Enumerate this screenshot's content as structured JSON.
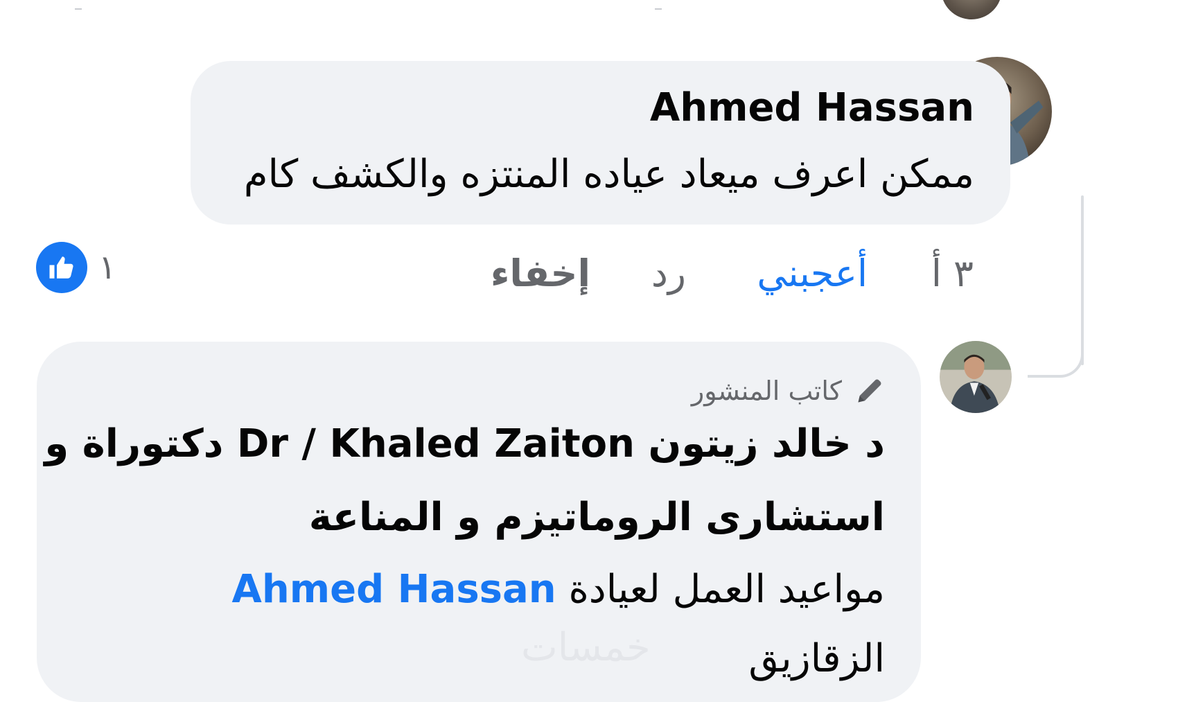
{
  "comment": {
    "author": "Ahmed Hassan",
    "text": "ممكن اعرف ميعاد عياده المنتزه والكشف كام",
    "actions": {
      "time": "٣ أ",
      "like": "أعجبني",
      "reply": "رد",
      "hide": "إخفاء"
    },
    "reaction_count": "١"
  },
  "reply": {
    "author_badge": "كاتب المنشور",
    "author_name_ar": "د خالد زيتون",
    "author_name_en": "Dr / Khaled Zaiton",
    "title_part1": "دكتوراة و",
    "title_part2": "استشارى الروماتيزم و المناعة",
    "mention": "Ahmed Hassan",
    "text_line3": "مواعيد العمل لعيادة",
    "text_line4": "الزقازيق"
  },
  "watermark": "خمسات",
  "colors": {
    "bubble": "#f0f2f5",
    "link": "#1877f2",
    "muted": "#65676b",
    "text": "#050505"
  },
  "icons": [
    "thumbs-up-icon",
    "pen-icon"
  ]
}
